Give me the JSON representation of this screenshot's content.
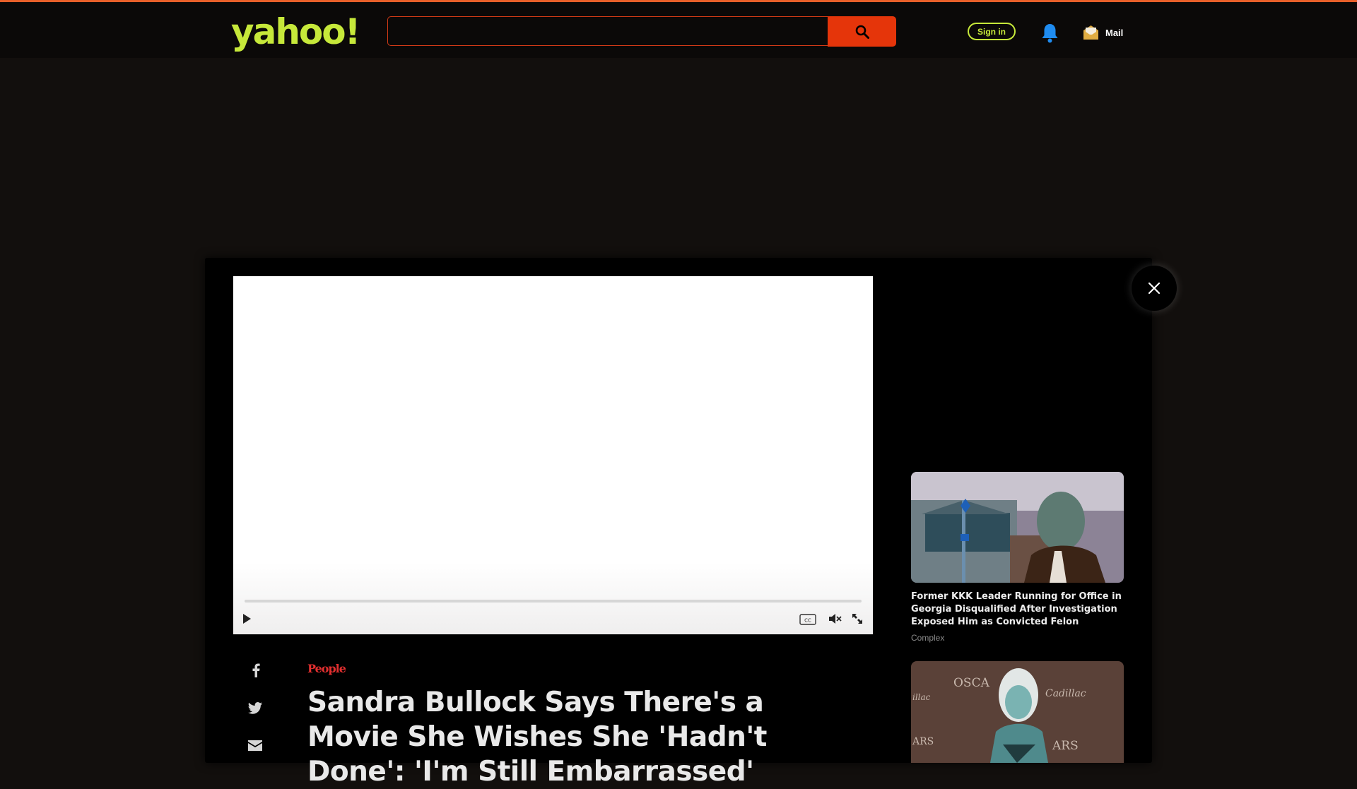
{
  "header": {
    "logo_text": "yahoo!",
    "search": {
      "value": "",
      "placeholder": ""
    },
    "signin_label": "Sign in",
    "mail_label": "Mail"
  },
  "icons": {
    "search": "search-icon",
    "bell": "bell-icon",
    "mail": "mail-icon",
    "close": "close-icon",
    "play": "play-icon",
    "cc": "closed-captions-icon",
    "mute": "mute-icon",
    "fullscreen": "fullscreen-icon",
    "facebook": "facebook-icon",
    "twitter": "twitter-icon",
    "email": "email-icon"
  },
  "video": {
    "progress": 0
  },
  "article": {
    "source": "People",
    "headline": "Sandra Bullock Says There's a Movie She Wishes She 'Hadn't Done': 'I'm Still Embarrassed'"
  },
  "sidebar": {
    "stories": [
      {
        "title": "Former KKK Leader Running for Office in Georgia Disqualified After Investigation Exposed Him as Convicted Felon",
        "source": "Complex"
      },
      {
        "title": "",
        "source": ""
      }
    ]
  },
  "colors": {
    "accent": "#c6e83a",
    "search_button": "#e5350a",
    "top_line": "#e8602a",
    "source_brand": "#e22f2f",
    "background": "#120f0d"
  }
}
